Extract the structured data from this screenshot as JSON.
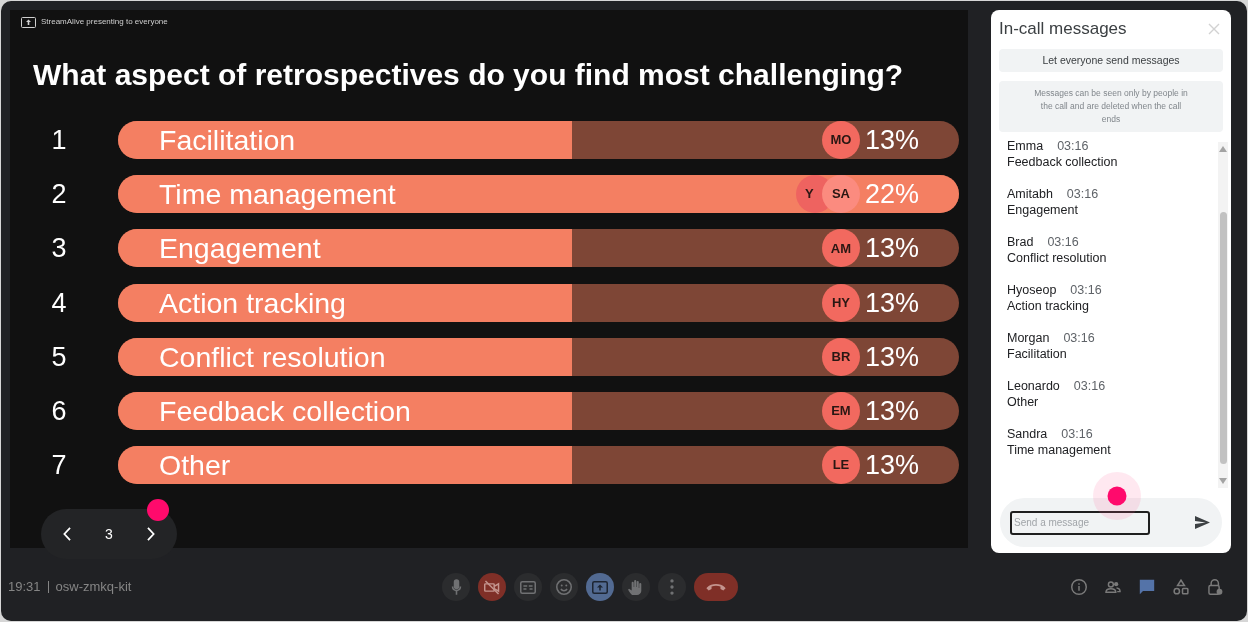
{
  "presentation": {
    "presenter_label": "StreamAlive presenting to everyone",
    "question": "What aspect of retrospectives do you find most challenging?",
    "options": [
      {
        "number": "1",
        "label": "Facilitation",
        "level": 0.54,
        "percent": "13%",
        "avatars": [
          {
            "initials": "MO",
            "color": "#f2695f"
          }
        ]
      },
      {
        "number": "2",
        "label": "Time management",
        "level": 1,
        "percent": "22%",
        "avatars": [
          {
            "initials": "Y",
            "color": "#ee6360"
          },
          {
            "initials": "SA",
            "color": "#fb8b7f"
          }
        ]
      },
      {
        "number": "3",
        "label": "Engagement",
        "level": 0.54,
        "percent": "13%",
        "avatars": [
          {
            "initials": "AM",
            "color": "#f2695f"
          }
        ]
      },
      {
        "number": "4",
        "label": "Action tracking",
        "level": 0.54,
        "percent": "13%",
        "avatars": [
          {
            "initials": "HY",
            "color": "#f2695f"
          }
        ]
      },
      {
        "number": "5",
        "label": "Conflict resolution",
        "level": 0.54,
        "percent": "13%",
        "avatars": [
          {
            "initials": "BR",
            "color": "#f2695f"
          }
        ]
      },
      {
        "number": "6",
        "label": "Feedback collection",
        "level": 0.54,
        "percent": "13%",
        "avatars": [
          {
            "initials": "EM",
            "color": "#f2695f"
          }
        ]
      },
      {
        "number": "7",
        "label": "Other",
        "level": 0.54,
        "percent": "13%",
        "avatars": [
          {
            "initials": "LE",
            "color": "#f2695f"
          }
        ]
      }
    ],
    "pager": {
      "page": "3"
    }
  },
  "chat_panel": {
    "title": "In-call messages",
    "toggle_button": "Let everyone send messages",
    "notice": "Messages can be seen only by people in the call and are deleted when the call ends",
    "messages": [
      {
        "name": "Emma",
        "time": "03:16",
        "text": "Feedback collection"
      },
      {
        "name": "Amitabh",
        "time": "03:16",
        "text": "Engagement"
      },
      {
        "name": "Brad",
        "time": "03:16",
        "text": "Conflict resolution"
      },
      {
        "name": "Hyoseop",
        "time": "03:16",
        "text": "Action tracking"
      },
      {
        "name": "Morgan",
        "time": "03:16",
        "text": "Facilitation"
      },
      {
        "name": "Leonardo",
        "time": "03:16",
        "text": "Other"
      },
      {
        "name": "Sandra",
        "time": "03:16",
        "text": "Time management"
      }
    ],
    "input": {
      "placeholder": "Send a message"
    }
  },
  "call_bar": {
    "time": "19:31",
    "meeting_code": "osw-zmkq-kit",
    "controls": [
      {
        "kind": "mic",
        "off": false,
        "active": false
      },
      {
        "kind": "camera",
        "off": true,
        "active": false
      },
      {
        "kind": "captions",
        "off": false,
        "active": false
      },
      {
        "kind": "reactions",
        "off": false,
        "active": false
      },
      {
        "kind": "present",
        "off": false,
        "active": true
      },
      {
        "kind": "hand",
        "off": false,
        "active": false
      },
      {
        "kind": "more",
        "off": false,
        "active": false
      },
      {
        "kind": "end-call",
        "off": true,
        "active": false
      }
    ],
    "side_buttons": [
      {
        "kind": "info",
        "selected": false
      },
      {
        "kind": "people",
        "selected": false
      },
      {
        "kind": "chat",
        "selected": true
      },
      {
        "kind": "activities",
        "selected": false
      },
      {
        "kind": "host-controls",
        "selected": false
      }
    ]
  }
}
